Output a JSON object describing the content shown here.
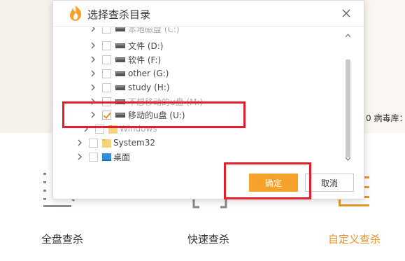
{
  "background": {
    "right_text": "0  病毒库：",
    "scan_options": [
      {
        "label": "全盘查杀",
        "active": false
      },
      {
        "label": "快速查杀",
        "active": false
      },
      {
        "label": "自定义查杀",
        "active": true
      }
    ]
  },
  "dialog": {
    "title": "选择查杀目录",
    "logo_icon": "flame-shield-icon",
    "close_icon": "close-icon",
    "tree": [
      {
        "label": "本地磁盘 (C:)",
        "type": "drive",
        "expanded": false,
        "checked": false,
        "faded": true
      },
      {
        "label": "文件 (D:)",
        "type": "drive",
        "expanded": false,
        "checked": false,
        "faded": false
      },
      {
        "label": "软件 (F:)",
        "type": "drive",
        "expanded": false,
        "checked": false,
        "faded": false
      },
      {
        "label": "other (G:)",
        "type": "drive",
        "expanded": false,
        "checked": false,
        "faded": false
      },
      {
        "label": "study (H:)",
        "type": "drive",
        "expanded": false,
        "checked": false,
        "faded": false
      },
      {
        "label": "不想移动的u盘 (M:)",
        "type": "drive",
        "expanded": false,
        "checked": false,
        "faded": true
      },
      {
        "label": "移动的u盘 (U:)",
        "type": "drive",
        "expanded": false,
        "checked": true,
        "faded": false
      },
      {
        "label": "Windows",
        "type": "folder",
        "expanded": false,
        "checked": false,
        "faded": true
      },
      {
        "label": "System32",
        "type": "folder",
        "expanded": false,
        "checked": false,
        "faded": false
      },
      {
        "label": "桌面",
        "type": "desktop",
        "expanded": false,
        "checked": false,
        "faded": false
      }
    ],
    "ok_label": "确定",
    "cancel_label": "取消"
  },
  "colors": {
    "accent": "#f5a12b",
    "highlight": "#e41d2d"
  }
}
